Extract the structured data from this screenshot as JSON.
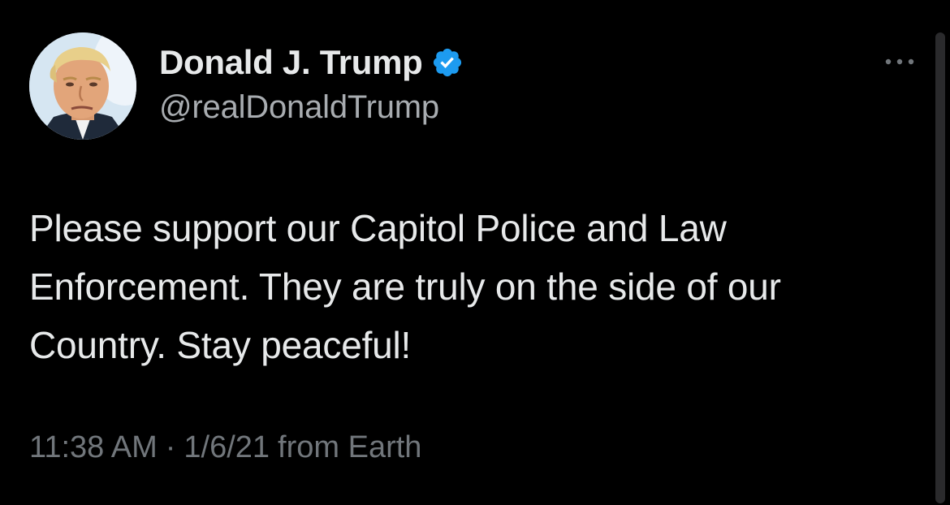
{
  "author": {
    "display_name": "Donald J. Trump",
    "handle": "@realDonaldTrump",
    "verified": true,
    "avatar_icon": "profile-photo"
  },
  "tweet": {
    "text": "Please support our Capitol Police and Law\nEnforcement. They are truly on the side of our\nCountry. Stay peaceful!",
    "time": "11:38 AM",
    "separator": "·",
    "date": "1/6/21",
    "source": "from Earth"
  },
  "icons": {
    "verified": "verified-badge-icon",
    "more": "more-options-icon"
  },
  "colors": {
    "background": "#000000",
    "primary_text": "#e7e9ea",
    "secondary_text": "#71767b",
    "verified_blue": "#1d9bf0"
  }
}
